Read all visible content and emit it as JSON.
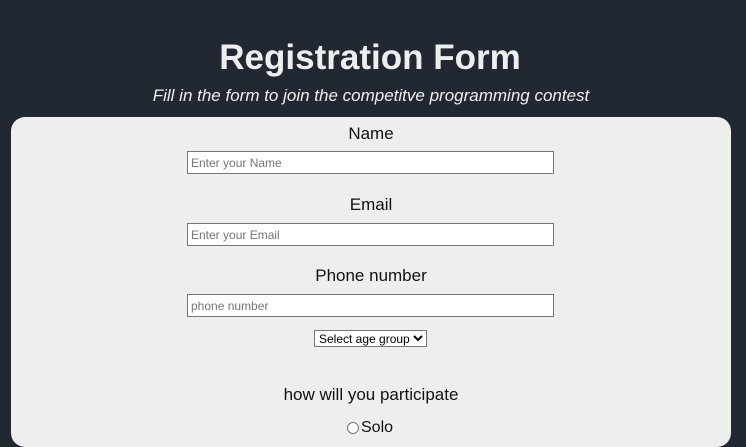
{
  "header": {
    "title": "Registration Form",
    "subtitle": "Fill in the form to join the competitve programming contest"
  },
  "form": {
    "name": {
      "label": "Name",
      "placeholder": "Enter your Name",
      "value": ""
    },
    "email": {
      "label": "Email",
      "placeholder": "Enter your Email",
      "value": ""
    },
    "phone": {
      "label": "Phone number",
      "placeholder": "phone number",
      "value": ""
    },
    "age_group": {
      "selected": "Select age group",
      "options": [
        "Select age group"
      ]
    },
    "participation": {
      "label": "how will you participate",
      "options": [
        {
          "label": "Solo",
          "checked": false
        }
      ]
    }
  },
  "colors": {
    "page_background": "#222831",
    "card_background": "#eeeeee",
    "title_text": "#eeeeee"
  }
}
